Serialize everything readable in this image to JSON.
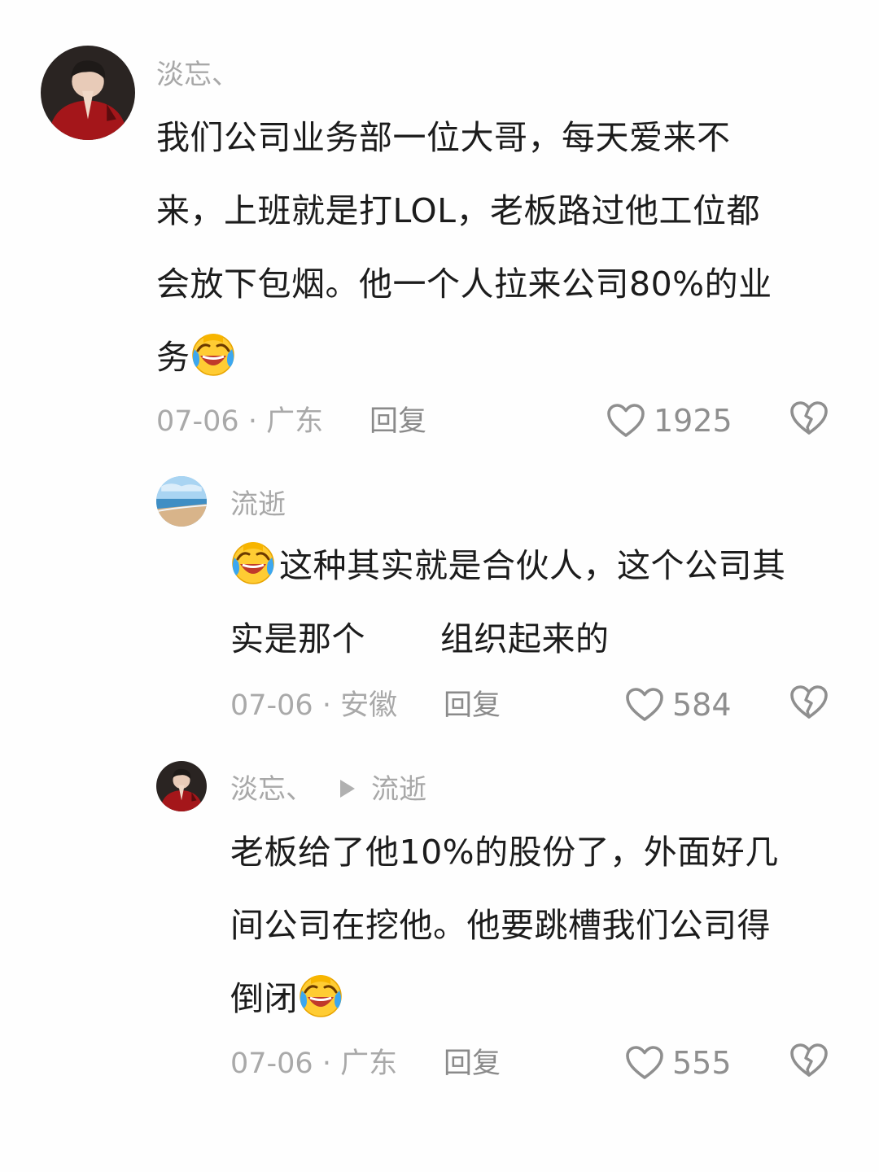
{
  "comments": [
    {
      "username": "淡忘、",
      "lines": [
        "我们公司业务部一位大哥，每天爱来不",
        "来，上班就是打LOL，老板路过他工位都",
        "会放下包烟。他一个人拉来公司80%的业",
        "务"
      ],
      "emoji": "laugh-cry-emoji",
      "date": "07-06",
      "location": "广东",
      "reply_label": "回复",
      "likes": "1925"
    },
    {
      "username": "流逝",
      "lines_part1": "这种其实就是合伙人，这个公司其",
      "line2a": "实是那个",
      "line2b": "组织起来的",
      "emoji": "laugh-cry-emoji",
      "date": "07-06",
      "location": "安徽",
      "reply_label": "回复",
      "likes": "584"
    },
    {
      "username": "淡忘、",
      "reply_to": "流逝",
      "lines": [
        "老板给了他10%的股份了，外面好几",
        "间公司在挖他。他要跳槽我们公司得",
        "倒闭"
      ],
      "emoji": "laugh-cry-emoji",
      "date": "07-06",
      "location": "广东",
      "reply_label": "回复",
      "likes": "555"
    }
  ],
  "separator": "·",
  "icons": {
    "like": "heart-outline-icon",
    "dislike": "broken-heart-icon",
    "reply_arrow": "play-triangle-icon"
  },
  "colors": {
    "username": "#a8a8a8",
    "text": "#1c1c1c",
    "meta": "#a9a9a9",
    "icon": "#8f8f8f"
  }
}
